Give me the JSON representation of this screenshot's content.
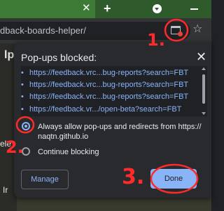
{
  "browser": {
    "address_text": "dback-boards-helper/"
  },
  "tabs": {
    "close_glyph": "✕",
    "new_tab_glyph": "+"
  },
  "popup": {
    "title": "Pop-ups blocked:",
    "blocked_urls": [
      "https://feedback.vrc...bug-reports?search=FBT",
      "https://feedback.vrc...bug-reports?search=FBT",
      "https://feedback.vrc...bug-reports?search=FBT",
      "https://feedback.vr.../open-beta?search=FBT"
    ],
    "options": {
      "allow": "Always allow pop-ups and redirects from https://\nnaqtn.github.io",
      "block": "Continue blocking"
    },
    "buttons": {
      "manage": "Manage",
      "done": "Done"
    },
    "close_glyph": "✕"
  },
  "background_page": {
    "heading_fragment": "lp",
    "side_fragment": "ele",
    "bottom_fragment": "Ir"
  },
  "annotations": {
    "step1": "1.",
    "step2": "2.",
    "step3": "3."
  },
  "colors": {
    "tab_strip": "#2f5a2c",
    "link": "#8ab4f8",
    "dialog_bg": "#292a2d",
    "annotation_red": "#ff2a2a"
  }
}
